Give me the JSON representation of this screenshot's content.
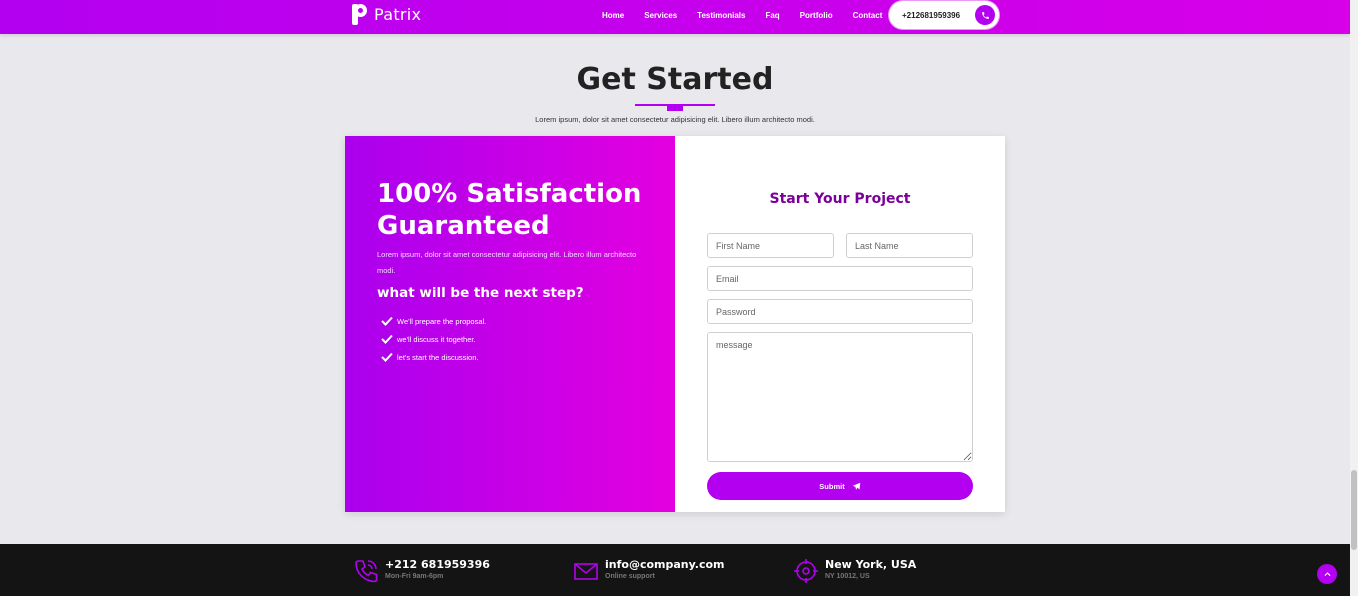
{
  "header": {
    "logo_text": "Patrix",
    "nav": [
      "Home",
      "Services",
      "Testimonials",
      "Faq",
      "Portfolio",
      "Contact"
    ],
    "phone": "+212681959396",
    "phone_icon": "phone-icon"
  },
  "section": {
    "title": "Get Started",
    "subtitle": "Lorem ipsum, dolor sit amet consectetur adipisicing elit. Libero illum architecto modi."
  },
  "promo": {
    "title": "100% Satisfaction Guaranteed",
    "description": "Lorem ipsum, dolor sit amet consectetur adipisicing elit. Libero illum architecto modi.",
    "next_step": "what will be the next step?",
    "steps": [
      "We'll prepare the proposal.",
      "we'll discuss it together.",
      "let's start the discussion."
    ]
  },
  "form": {
    "title": "Start Your Project",
    "first_name_placeholder": "First Name",
    "last_name_placeholder": "Last Name",
    "email_placeholder": "Email",
    "password_placeholder": "Password",
    "message_placeholder": "message",
    "submit_label": "Submit",
    "submit_icon": "paper-plane-icon"
  },
  "footer": {
    "contacts": [
      {
        "icon": "phone-icon",
        "main": "+212 681959396",
        "sub": "Mon-Fri 9am-6pm"
      },
      {
        "icon": "mail-icon",
        "main": "info@company.com",
        "sub": "Online support"
      },
      {
        "icon": "location-icon",
        "main": "New York, USA",
        "sub": "NY 10012, US"
      }
    ],
    "back_to_top_icon": "chevron-up-icon"
  },
  "colors": {
    "accent": "#b300f0",
    "accent_light": "#e300e0",
    "form_title": "#7b0099",
    "footer_bg": "#141414",
    "page_bg": "#e9e9ed"
  }
}
